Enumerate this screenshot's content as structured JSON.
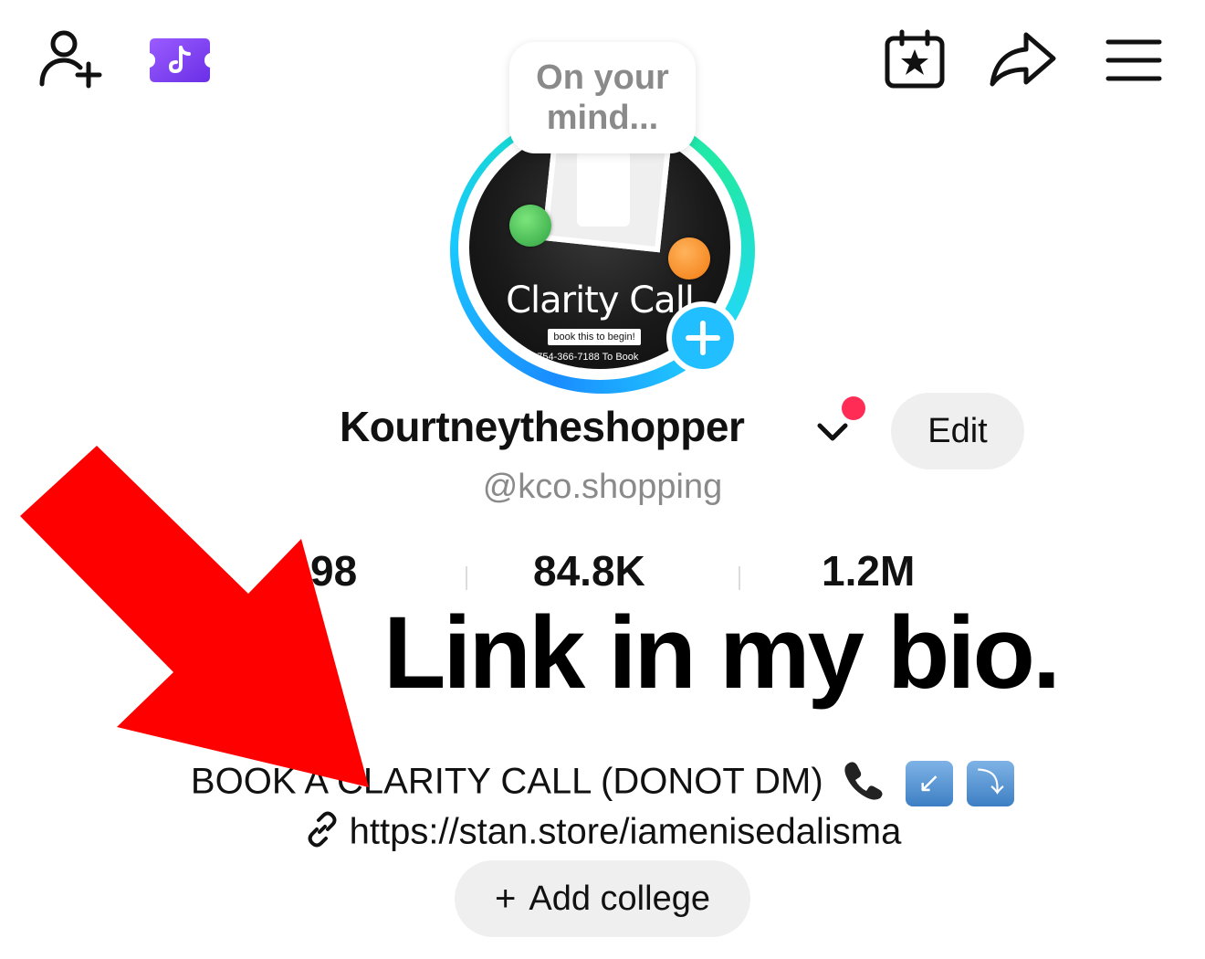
{
  "topbar": {
    "add_friend_icon": "person-plus-icon",
    "tiktok_ticket_icon": "tiktok-ticket-icon",
    "calendar_icon": "calendar-star-icon",
    "share_icon": "share-arrow-icon",
    "menu_icon": "hamburger-menu-icon"
  },
  "note_bubble": {
    "text": "On your mind..."
  },
  "avatar": {
    "brand_text": "Clarity Call",
    "pill_text": "book this to begin!",
    "phone_text": "754-366-7188 To Book"
  },
  "profile": {
    "username": "Kourtneytheshopper",
    "handle": "@kco.shopping",
    "edit_label": "Edit"
  },
  "stats": {
    "following_value": "98",
    "followers_value": "84.8K",
    "likes_value": "1.2M"
  },
  "overlay": {
    "caption": "Link in my bio."
  },
  "bio": {
    "text": "BOOK A CLARITY CALL (DONOT DM)",
    "link": "https://stan.store/iamenisedalisma",
    "add_college_label": "Add college"
  },
  "colors": {
    "accent_blue": "#21bfff",
    "notification_red": "#ff2d55",
    "arrow_red": "#ff0000",
    "tiktok_purple": "#7b3ff2"
  }
}
